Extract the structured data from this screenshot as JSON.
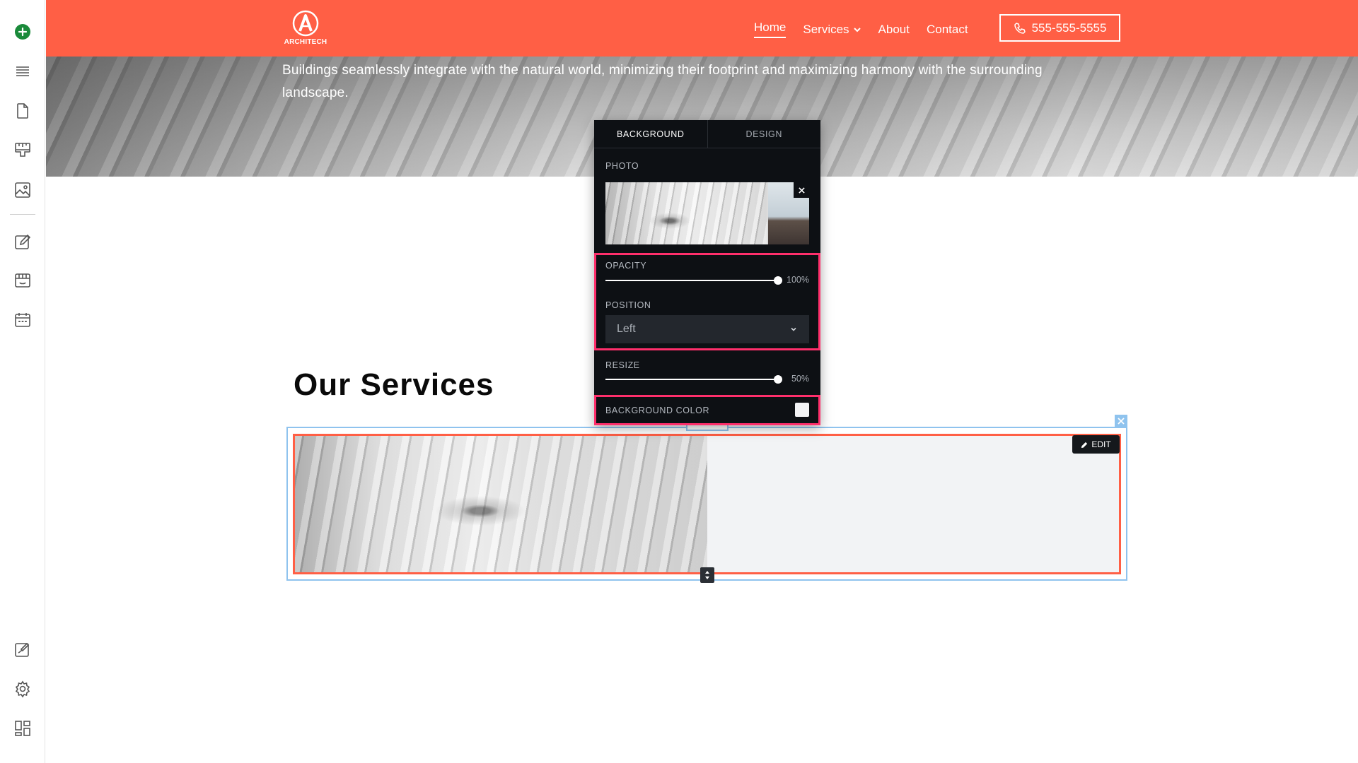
{
  "header": {
    "logo_text": "ARCHITECH",
    "nav": [
      {
        "label": "Home",
        "active": true
      },
      {
        "label": "Services",
        "has_dropdown": true
      },
      {
        "label": "About"
      },
      {
        "label": "Contact"
      }
    ],
    "phone": "555-555-5555",
    "color": "#ff5f45"
  },
  "hero": {
    "text": "Buildings seamlessly integrate with the natural world, minimizing their footprint and maximizing harmony with the surrounding landscape."
  },
  "services": {
    "title": "Our Services",
    "edit_label": "EDIT"
  },
  "panel": {
    "tabs": [
      {
        "label": "BACKGROUND",
        "active": true
      },
      {
        "label": "DESIGN",
        "active": false
      }
    ],
    "photo_label": "PHOTO",
    "opacity_label": "OPACITY",
    "opacity_value": "100%",
    "opacity_fraction": 1.0,
    "position_label": "POSITION",
    "position_value": "Left",
    "resize_label": "RESIZE",
    "resize_value": "50%",
    "resize_fraction": 1.0,
    "bg_color_label": "BACKGROUND COLOR",
    "bg_color": "#f2f3f5",
    "highlight_color": "#ff2f6c"
  },
  "sidebar": {
    "top_icons": [
      "add-icon",
      "layers-icon",
      "pages-icon",
      "paint-icon",
      "media-icon"
    ],
    "mid_icons": [
      "edit-icon",
      "store-icon",
      "calendar-icon"
    ],
    "bottom_icons": [
      "design-icon",
      "settings-icon",
      "apps-icon"
    ],
    "accent_color": "#1a8a3a"
  }
}
